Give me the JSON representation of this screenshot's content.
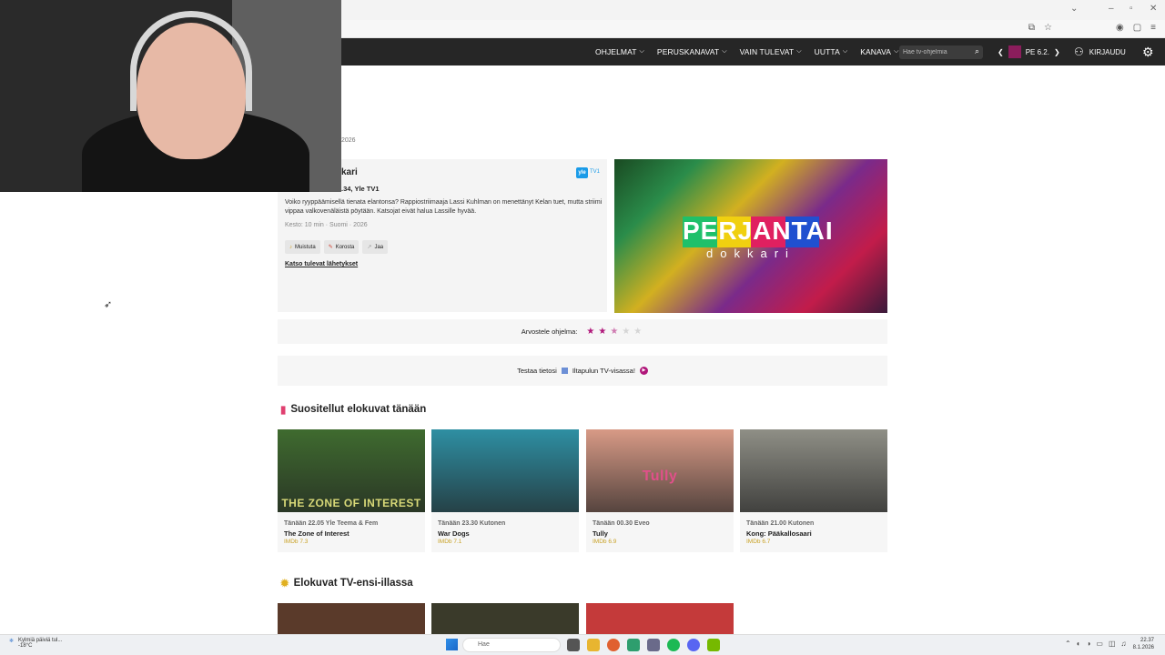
{
  "browser": {
    "url_icons": [
      "translate-icon",
      "star-icon",
      "extension-icon",
      "share-icon",
      "menu-icon"
    ]
  },
  "nav": {
    "items": [
      {
        "label": "OHJELMAT"
      },
      {
        "label": "PERUSKANAVAT"
      },
      {
        "label": "VAIN TULEVAT"
      },
      {
        "label": "UUTTA"
      },
      {
        "label": "KANAVA"
      }
    ],
    "search_placeholder": "Hae tv-ohjelmia",
    "date_label": "PE 6.2.",
    "login_label": "KIRJAUDU"
  },
  "program": {
    "date_small": "2026",
    "title": "kari",
    "time": ".34, Yle TV1",
    "channel_logo": "yle",
    "channel_tag": "TV1",
    "description": "Voiko ryyppäämisellä tienata elantonsa? Rappiostriimaaja Lassi Kuhlman on menettänyt Kelan tuet, mutta striimi vippaa valkovenäläistä pöytään. Katsojat eivät halua Lassille hyvää.",
    "meta": "Kesto: 10 min · Suomi · 2026",
    "actions": [
      {
        "label": "Muistuta",
        "icon": "bell-icon"
      },
      {
        "label": "Korosta",
        "icon": "pen-icon"
      },
      {
        "label": "Jaa",
        "icon": "share-icon"
      }
    ],
    "upcoming_link": "Katso tulevat lähetykset",
    "hero_title": "PERJANTAI",
    "hero_subtitle": "dokkari"
  },
  "rating": {
    "label": "Arvostele ohjelma:",
    "value": 2.5,
    "max": 5
  },
  "quiz": {
    "text_before": "Testaa tietosi",
    "text_after": "Iltapulun TV-visassa!"
  },
  "section_recommended": {
    "title": "Suositellut elokuvat tänään",
    "movies": [
      {
        "time": "Tänään 22.05 Yle Teema & Fem",
        "title": "The Zone of Interest",
        "imdb": "IMDb 7.3",
        "poster_text": "THE ZONE OF INTEREST",
        "color": "#3f6b2f"
      },
      {
        "time": "Tänään 23.30 Kutonen",
        "title": "War Dogs",
        "imdb": "IMDb 7.1",
        "poster_text": "",
        "color": "#2e8fa3"
      },
      {
        "time": "Tänään 00.30 Eveo",
        "title": "Tully",
        "imdb": "IMDb 6.9",
        "poster_text": "Tully",
        "color": "#d89a86"
      },
      {
        "time": "Tänään 21.00 Kutonen",
        "title": "Kong: Pääkallosaari",
        "imdb": "IMDb 6.7",
        "poster_text": "",
        "color": "#8f8f86"
      }
    ]
  },
  "section_premieres": {
    "title": "Elokuvat TV-ensi-illassa",
    "colors": [
      "#5a3a2a",
      "#3a3a2a",
      "#c43a3a"
    ]
  },
  "taskbar": {
    "weather": "Kylmiä päiviä tul...",
    "temp": "-18°C",
    "search_placeholder": "Hae",
    "time": "22.37",
    "date": "8.1.2026"
  }
}
